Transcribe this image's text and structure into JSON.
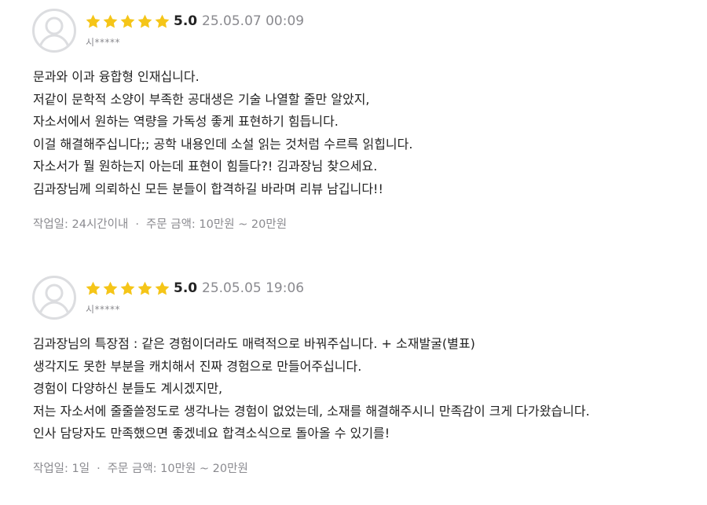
{
  "colors": {
    "star": "#f5c518",
    "muted": "#8a8a8f",
    "text": "#222222",
    "avatar_border": "#dcdde0"
  },
  "reviews": [
    {
      "rating": "5.0",
      "stars": 5,
      "date": "25.05.07 00:09",
      "user": "시*****",
      "lines": [
        "문과와 이과 융합형 인재십니다.",
        "저같이 문학적 소양이 부족한 공대생은 기술 나열할 줄만 알았지,",
        "자소서에서 원하는 역량을 가독성 좋게 표현하기 힘듭니다.",
        "이걸 해결해주십니다;; 공학 내용인데 소설 읽는 것처럼 수르륵 읽힙니다.",
        "자소서가 뭘 원하는지 아는데 표현이 힘들다?! 김과장님 찾으세요.",
        "김과장님께 의뢰하신 모든 분들이 합격하길 바라며 리뷰 남깁니다!!"
      ],
      "work_period": "작업일: 24시간이내",
      "separator": "·",
      "order_amount": "주문 금액: 10만원 ~ 20만원"
    },
    {
      "rating": "5.0",
      "stars": 5,
      "date": "25.05.05 19:06",
      "user": "시*****",
      "lines": [
        "김과장님의 특장점 : 같은 경험이더라도 매력적으로 바꿔주십니다. + 소재발굴(별표)",
        "생각지도 못한 부분을 캐치해서 진짜 경험으로 만들어주십니다.",
        "경험이 다양하신 분들도 계시겠지만,",
        "저는 자소서에 줄줄쓸정도로 생각나는 경험이 없었는데, 소재를 해결해주시니 만족감이 크게 다가왔습니다.",
        "인사 담당자도 만족했으면 좋겠네요 합격소식으로 돌아올 수 있기를!"
      ],
      "work_period": "작업일: 1일",
      "separator": "·",
      "order_amount": "주문 금액: 10만원 ~ 20만원"
    }
  ]
}
